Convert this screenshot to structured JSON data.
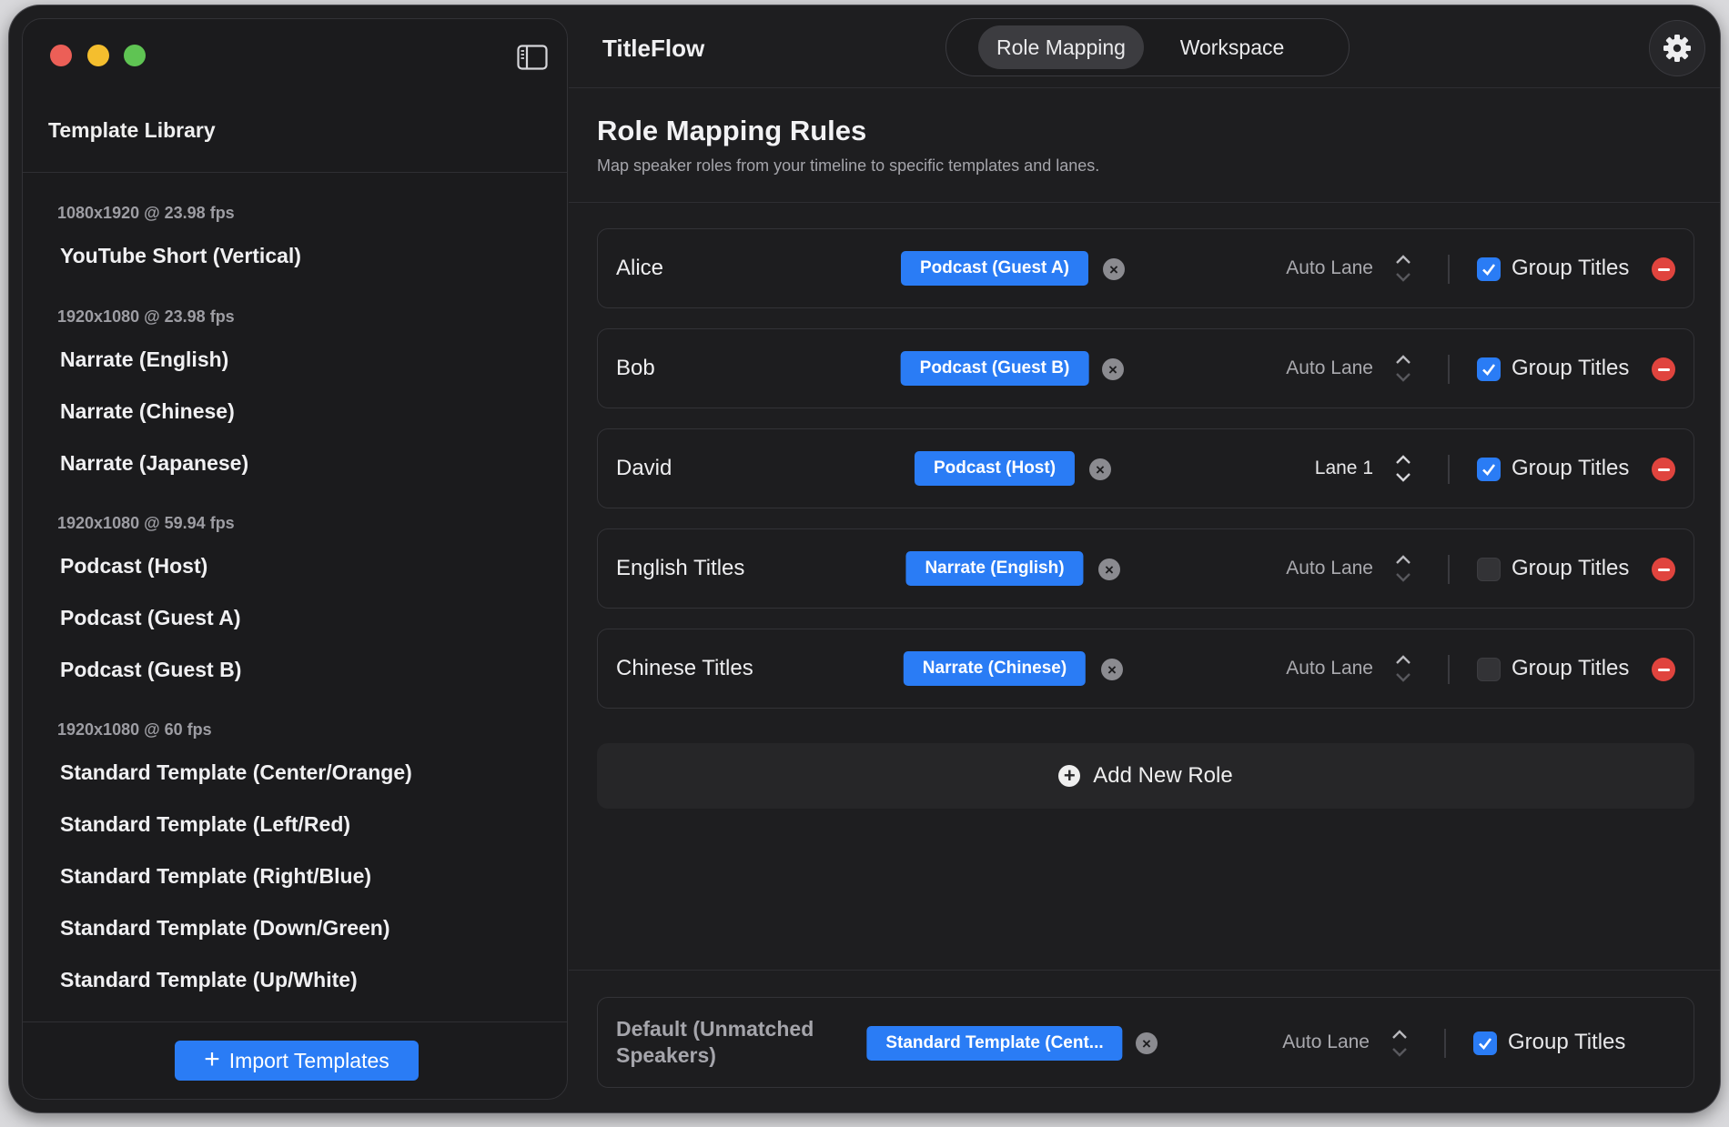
{
  "app": {
    "title": "TitleFlow"
  },
  "tabs": [
    {
      "label": "Role Mapping",
      "active": true
    },
    {
      "label": "Workspace",
      "active": false
    }
  ],
  "sidebar": {
    "title": "Template Library",
    "groups": [
      {
        "header": "1080x1920 @ 23.98 fps",
        "items": [
          "YouTube Short (Vertical)"
        ]
      },
      {
        "header": "1920x1080 @ 23.98 fps",
        "items": [
          "Narrate (English)",
          "Narrate (Chinese)",
          "Narrate (Japanese)"
        ]
      },
      {
        "header": "1920x1080 @ 59.94 fps",
        "items": [
          "Podcast (Host)",
          "Podcast (Guest A)",
          "Podcast (Guest B)"
        ]
      },
      {
        "header": "1920x1080 @ 60 fps",
        "items": [
          "Standard Template (Center/Orange)",
          "Standard Template (Left/Red)",
          "Standard Template (Right/Blue)",
          "Standard Template (Down/Green)",
          "Standard Template (Up/White)"
        ]
      }
    ],
    "import_label": "Import Templates"
  },
  "main": {
    "title": "Role Mapping Rules",
    "subtitle": "Map speaker roles from your timeline to specific templates and lanes.",
    "rules": [
      {
        "name": "Alice",
        "template": "Podcast (Guest A)",
        "lane": "Auto Lane",
        "group_titles": true,
        "group_label": "Group Titles"
      },
      {
        "name": "Bob",
        "template": "Podcast (Guest B)",
        "lane": "Auto Lane",
        "group_titles": true,
        "group_label": "Group Titles"
      },
      {
        "name": "David",
        "template": "Podcast (Host)",
        "lane": "Lane 1",
        "group_titles": true,
        "group_label": "Group Titles"
      },
      {
        "name": "English Titles",
        "template": "Narrate (English)",
        "lane": "Auto Lane",
        "group_titles": false,
        "group_label": "Group Titles"
      },
      {
        "name": "Chinese Titles",
        "template": "Narrate (Chinese)",
        "lane": "Auto Lane",
        "group_titles": false,
        "group_label": "Group Titles"
      }
    ],
    "add_role_label": "Add New Role",
    "default_rule": {
      "name_line1": "Default (Unmatched",
      "name_line2": "Speakers)",
      "template": "Standard Template (Cent...",
      "lane": "Auto Lane",
      "group_titles": true,
      "group_label": "Group Titles"
    }
  },
  "colors": {
    "accent": "#2a7cf5",
    "remove": "#e0443e",
    "window_bg": "#1e1e20"
  },
  "icons": [
    "sidebar-toggle-icon",
    "gear-icon",
    "clear-icon",
    "stepper-icon",
    "checkmark-icon",
    "remove-icon",
    "plus-circle-icon",
    "plus-icon"
  ]
}
